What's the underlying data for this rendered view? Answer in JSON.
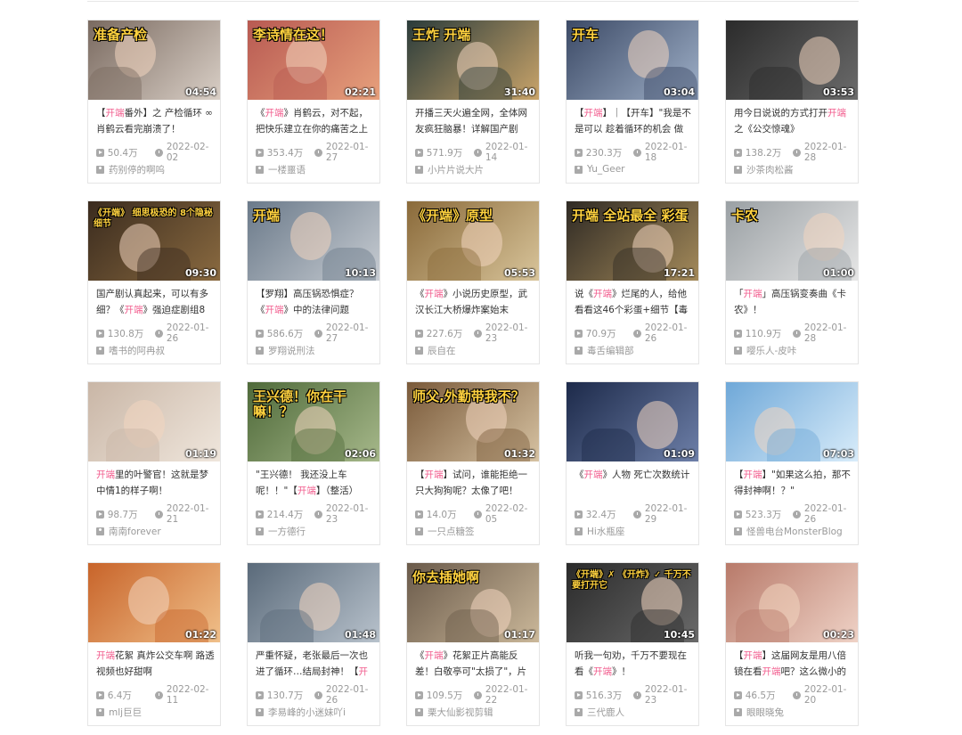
{
  "colors": {
    "highlight": "#f25d8e",
    "meta": "#999999",
    "title": "#333333"
  },
  "icons": {
    "views": "play-count-icon",
    "date": "clock-icon",
    "uploader": "up-user-icon"
  },
  "videos": [
    {
      "pre": "【",
      "hl": "开端",
      "post": "番外】之 产检循环 ∞ 肖鹤云看完崩溃了！",
      "views": "50.4万",
      "date": "2022-02-02",
      "uploader": "药别停的啊呜",
      "duration": "04:54",
      "overlay": "准备产检",
      "c1": "#7a6a60",
      "c2": "#d9cfc6"
    },
    {
      "pre": "《",
      "hl": "开端",
      "post": "》肖鹤云，对不起，把快乐建立在你的痛苦之上",
      "views": "353.4万",
      "date": "2022-01-27",
      "uploader": "一楼噩语",
      "duration": "02:21",
      "overlay": "李诗情在这！",
      "c1": "#b85a52",
      "c2": "#e7a07c"
    },
    {
      "pre": "开播三天火遍全网，全体网友疯狂脑暴！详解国产剧",
      "hl": "",
      "post": "",
      "views": "571.9万",
      "date": "2022-01-14",
      "uploader": "小片片说大片",
      "duration": "31:40",
      "overlay": "王炸 开端",
      "c1": "#2a3b3a",
      "c2": "#c9a46a"
    },
    {
      "pre": "【",
      "hl": "开端",
      "post": "】｜【开车】\"我是不是可以 趁着循环的机会 做",
      "views": "230.3万",
      "date": "2022-01-18",
      "uploader": "Yu_Geer",
      "duration": "03:04",
      "overlay": "开车",
      "c1": "#3c4a66",
      "c2": "#9fb0c8"
    },
    {
      "pre": "用今日说说的方式打开",
      "hl": "开端",
      "post": "之《公交惊魂》",
      "views": "138.2万",
      "date": "2022-01-28",
      "uploader": "沙茶肉松酱",
      "duration": "03:53",
      "overlay": "",
      "c1": "#2b2b2b",
      "c2": "#6b6b6b"
    },
    {
      "pre": "国产剧认真起来，可以有多细？《",
      "hl": "开端",
      "post": "》强迫症剧组8",
      "views": "130.8万",
      "date": "2022-01-26",
      "uploader": "嗜书的阿冉叔",
      "duration": "09:30",
      "overlay": "《开端》 细思极恐的 8个隐秘细节",
      "c1": "#3a2b1e",
      "c2": "#8a6a40"
    },
    {
      "pre": "【罗翔】高压锅恐惧症？《",
      "hl": "开端",
      "post": "》中的法律问题",
      "views": "586.6万",
      "date": "2022-01-27",
      "uploader": "罗翔说刑法",
      "duration": "10:13",
      "overlay": "开端",
      "c1": "#6b7a8a",
      "c2": "#c7ccd2"
    },
    {
      "pre": "《",
      "hl": "开端",
      "post": "》小说历史原型，武汉长江大桥爆炸案始末",
      "views": "227.6万",
      "date": "2022-01-23",
      "uploader": "辰自在",
      "duration": "05:53",
      "overlay": "《开端》原型",
      "c1": "#8a6a3a",
      "c2": "#d8c49a"
    },
    {
      "pre": "说《",
      "hl": "开端",
      "post": "》烂尾的人，给他看看这46个彩蛋+细节【毒",
      "views": "70.9万",
      "date": "2022-01-26",
      "uploader": "毒舌编辑部",
      "duration": "17:21",
      "overlay": "开端 全站最全 彩蛋",
      "c1": "#2f2a24",
      "c2": "#a48a5a"
    },
    {
      "pre": "「",
      "hl": "开端",
      "post": "」高压锅变奏曲《卡农》！",
      "views": "110.9万",
      "date": "2022-01-28",
      "uploader": "嘤乐人-皮咔",
      "duration": "01:00",
      "overlay": "卡农",
      "c1": "#9aa0a4",
      "c2": "#e6e6e6"
    },
    {
      "pre": "",
      "hl": "开端",
      "post": "里的叶警官！这就是梦中情1的样子啊！",
      "views": "98.7万",
      "date": "2022-01-21",
      "uploader": "南南forever",
      "duration": "01:19",
      "overlay": "",
      "c1": "#c9b6a6",
      "c2": "#efe6dc"
    },
    {
      "pre": "\"王兴德！ 我还没上车呢！！\"【",
      "hl": "开端",
      "post": "】（整活）",
      "views": "214.4万",
      "date": "2022-01-23",
      "uploader": "一方德行",
      "duration": "02:06",
      "overlay": "王兴德！你在干嘛！？",
      "c1": "#4f6a3a",
      "c2": "#a6b88a"
    },
    {
      "pre": "【",
      "hl": "开端",
      "post": "】试问，谁能拒绝一只大狗狗呢？太像了吧！",
      "views": "14.0万",
      "date": "2022-02-05",
      "uploader": "一只点糖签",
      "duration": "01:32",
      "overlay": "师父,外勤带我不？",
      "c1": "#7a5a3a",
      "c2": "#d6c2a2"
    },
    {
      "pre": "《",
      "hl": "开端",
      "post": "》人物 死亡次数统计",
      "views": "32.4万",
      "date": "2022-01-29",
      "uploader": "Hi水瓶座",
      "duration": "01:09",
      "overlay": "",
      "c1": "#1d2a4a",
      "c2": "#6d7fa8"
    },
    {
      "pre": "【",
      "hl": "开端",
      "post": "】\"如果这么拍，那不得封神啊！？\"",
      "views": "523.3万",
      "date": "2022-01-26",
      "uploader": "怪兽电台MonsterBlog",
      "duration": "07:03",
      "overlay": "",
      "c1": "#6fa8d8",
      "c2": "#d8ecfa"
    },
    {
      "pre": "",
      "hl": "开端",
      "post": "花絮 真炸公交车啊 路透视频也好甜啊",
      "views": "6.4万",
      "date": "2022-02-11",
      "uploader": "mlj巨巨",
      "duration": "01:22",
      "overlay": "",
      "c1": "#c8642a",
      "c2": "#f0c08a"
    },
    {
      "pre": "严重怀疑，老张最后一次也进了循环…结局封神！【",
      "hl": "开",
      "post": "",
      "views": "130.7万",
      "date": "2022-01-26",
      "uploader": "李易峰的小迷妹吖i",
      "duration": "01:48",
      "overlay": "",
      "c1": "#5a6a7a",
      "c2": "#b8c2cc"
    },
    {
      "pre": "《",
      "hl": "开端",
      "post": "》花絮正片高能反差！白敬亭可\"太损了\"，片",
      "views": "109.5万",
      "date": "2022-01-22",
      "uploader": "栗大仙影视剪辑",
      "duration": "01:17",
      "overlay": "你去插她啊",
      "c1": "#6a5a4a",
      "c2": "#cbb89a"
    },
    {
      "pre": "听我一句劝，千万不要现在看《",
      "hl": "开端",
      "post": "》！",
      "views": "516.3万",
      "date": "2022-01-23",
      "uploader": "三代鹿人",
      "duration": "10:45",
      "overlay": "《开端》✗ 《开炸》✓ 千万不要打开它",
      "c1": "#2a2a2a",
      "c2": "#6a6a6a"
    },
    {
      "pre": "【",
      "hl": "开端",
      "post": "】这届网友是用八倍镜在看",
      "hl2": "开端",
      "post2": "吧？这么微小的",
      "views": "46.5万",
      "date": "2022-01-20",
      "uploader": "眼眼晓兔",
      "duration": "00:23",
      "overlay": "",
      "c1": "#b87a6a",
      "c2": "#efd2c6"
    }
  ]
}
